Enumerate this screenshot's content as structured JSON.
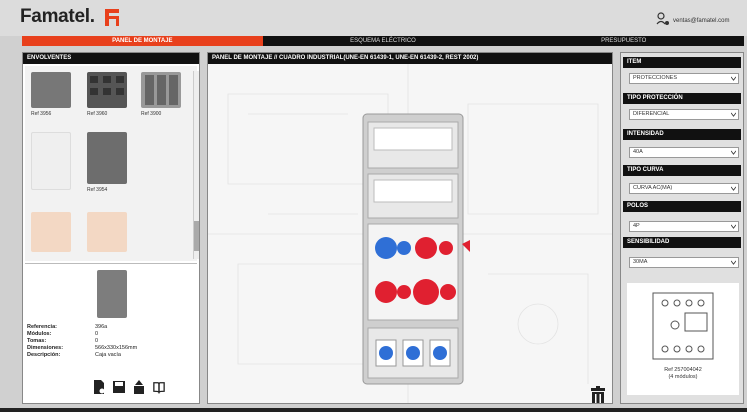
{
  "brand": {
    "name": "Famatel.",
    "accent": "#e8401c"
  },
  "user": {
    "email": "ventas@famatel.com",
    "icon": "user-icon"
  },
  "tabs": [
    {
      "label": "PANEL DE MONTAJE",
      "active": true
    },
    {
      "label": "ESQUEMA ELÉCTRICO",
      "active": false
    },
    {
      "label": "PRESUPUESTO",
      "active": false
    }
  ],
  "left": {
    "title": "ENVOLVENTES",
    "items": [
      {
        "label": "Ref 3956"
      },
      {
        "label": "Ref 3960"
      },
      {
        "label": "Ref 3900"
      },
      {
        "label": "Ref 3954"
      }
    ],
    "detail": {
      "rows": [
        {
          "key": "Referencia:",
          "value": "396a"
        },
        {
          "key": "Módulos:",
          "value": "0"
        },
        {
          "key": "Tomas:",
          "value": "0"
        },
        {
          "key": "Dimensiones:",
          "value": "566x330x156mm"
        },
        {
          "key": "Descripción:",
          "value": "Caja vacía"
        }
      ],
      "actions": [
        "document-add-icon",
        "save-icon",
        "upload-icon",
        "book-icon"
      ]
    }
  },
  "center": {
    "title": "PANEL DE MONTAJE // CUADRO INDUSTRIAL(UNE-EN 61439-1, UNE-EN 61439-2, REST 2002)",
    "trash_icon": "trash-icon"
  },
  "right": {
    "fields": [
      {
        "label": "ITEM",
        "value": "PROTECCIONES"
      },
      {
        "label": "TIPO PROTECCIÓN",
        "value": "DIFERENCIAL"
      },
      {
        "label": "INTENSIDAD",
        "value": "40A"
      },
      {
        "label": "TIPO CURVA",
        "value": "CURVA AC(MA)"
      },
      {
        "label": "POLOS",
        "value": "4P"
      },
      {
        "label": "SENSIBILIDAD",
        "value": "30mA"
      }
    ],
    "preview": {
      "ref": "Ref 257004042",
      "modules": "(4 módulos)"
    }
  }
}
